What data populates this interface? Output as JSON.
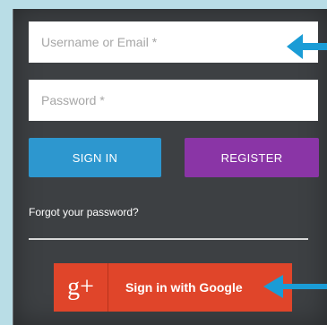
{
  "form": {
    "username_placeholder": "Username or Email *",
    "password_placeholder": "Password *",
    "signin_label": "SIGN IN",
    "register_label": "REGISTER",
    "forgot_label": "Forgot your password?",
    "google_icon_text": "g+",
    "google_label": "Sign in with Google"
  },
  "colors": {
    "background": "#b9dde6",
    "panel": "#3d4043",
    "signin": "#2d97cf",
    "register": "#8a35a6",
    "google": "#e0452a",
    "arrow": "#1a9cd6"
  },
  "icons": {
    "google": "google-plus-icon",
    "pointer": "arrow-left-icon"
  }
}
